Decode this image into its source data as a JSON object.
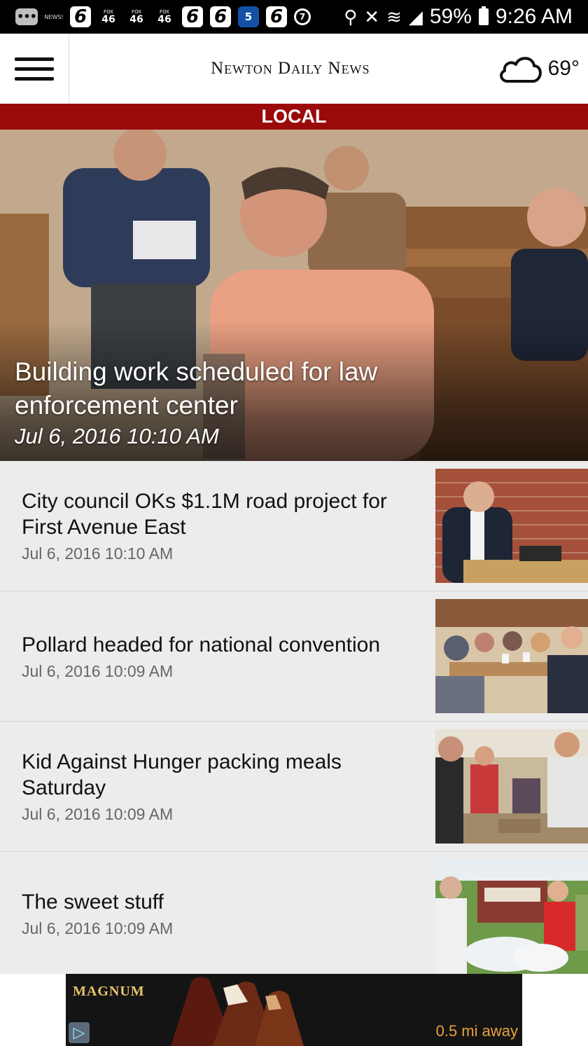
{
  "status_bar": {
    "news_label": "NEWS!",
    "six_label": "6",
    "fox_label": "FOX",
    "fox_number": "46",
    "nbc_label": "5",
    "battery": "59%",
    "time": "9:26 AM"
  },
  "header": {
    "masthead": "Newton Daily News",
    "temperature": "69°"
  },
  "section": {
    "title": "LOCAL"
  },
  "hero": {
    "headline": "Building work scheduled for law enforcement center",
    "date": "Jul 6, 2016 10:10 AM"
  },
  "articles": [
    {
      "headline": "City council OKs $1.1M road project for First Avenue East",
      "date": "Jul 6, 2016 10:10 AM"
    },
    {
      "headline": "Pollard headed for national convention",
      "date": "Jul 6, 2016 10:09 AM"
    },
    {
      "headline": "Kid Against Hunger packing meals Saturday",
      "date": "Jul 6, 2016 10:09 AM"
    },
    {
      "headline": "The sweet stuff",
      "date": "Jul 6, 2016 10:09 AM"
    }
  ],
  "ad": {
    "brand": "MAGNUM",
    "distance": "0.5 mi away"
  },
  "colors": {
    "section_bar": "#9b0a0a",
    "status_bar": "#000000",
    "list_background": "#ececec"
  }
}
